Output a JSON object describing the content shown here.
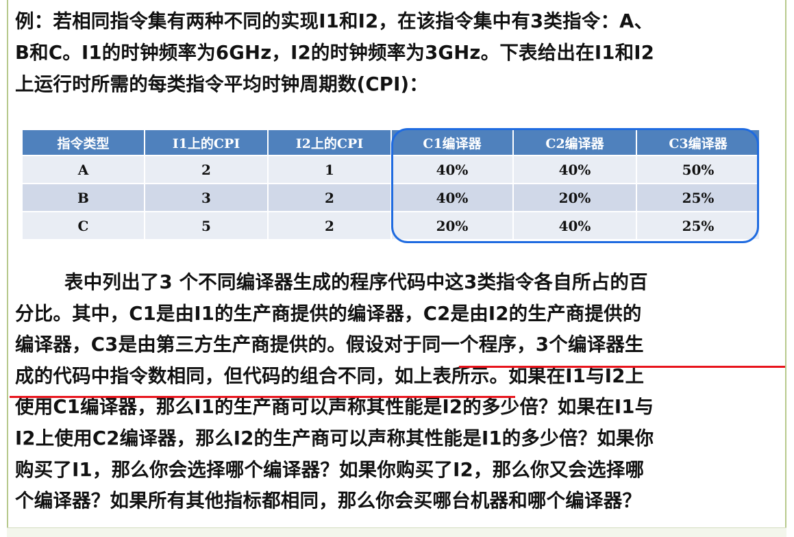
{
  "intro_lines": [
    "例：若相同指令集有两种不同的实现I1和I2，在该指令集中有3类指令：A、",
    "B和C。I1的时钟频率为6GHz，I2的时钟频率为3GHz。下表给出在I1和I2",
    "上运行时所需的每类指令平均时钟周期数(CPI)："
  ],
  "table": {
    "headers": [
      "指令类型",
      "I1上的CPI",
      "I2上的CPI",
      "C1编译器",
      "C2编译器",
      "C3编译器"
    ],
    "rows": [
      [
        "A",
        "2",
        "1",
        "40%",
        "40%",
        "50%"
      ],
      [
        "B",
        "3",
        "2",
        "40%",
        "20%",
        "25%"
      ],
      [
        "C",
        "5",
        "2",
        "20%",
        "40%",
        "25%"
      ]
    ]
  },
  "paragraph_lines": [
    "表中列出了3 个不同编译器生成的程序代码中这3类指令各自所占的百",
    "分比。其中，C1是由I1的生产商提供的编译器，C2是由I2的生产商提供的",
    "编译器，C3是由第三方生产商提供的。假设对于同一个程序，3个编译器生",
    "成的代码中指令数相同，但代码的组合不同，如上表所示。如果在I1与I2上",
    "使用C1编译器，那么I1的生产商可以声称其性能是I2的多少倍？如果在I1与",
    "I2上使用C2编译器，那么I2的生产商可以声称其性能是I1的多少倍？如果你",
    "购买了I1，那么你会选择哪个编译器？如果你购买了I2，那么你又会选择哪",
    "个编译器？如果所有其他指标都相同，那么你会买哪台机器和哪个编译器？"
  ],
  "colors": {
    "table_header": "#4f81bd",
    "table_row_light": "#e9edf4",
    "table_row_dark": "#d0d8e8",
    "highlight_box": "#1f6be0",
    "underline": "#e8131b"
  }
}
